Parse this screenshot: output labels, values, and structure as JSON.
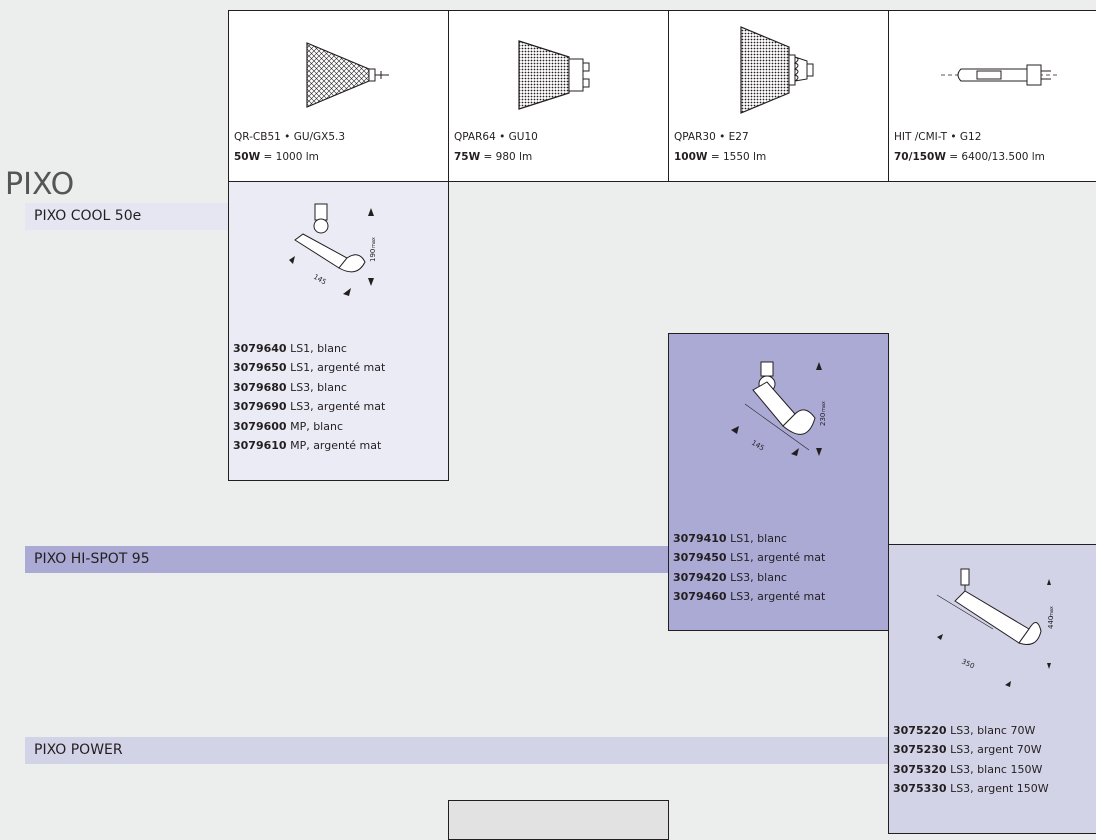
{
  "family_title": "PIXO",
  "lamps": [
    {
      "name": "QR-CB51 • GU/GX5.3",
      "power": "50W",
      "flux": " = 1000 lm",
      "icon": "mr16-reflector-lamp"
    },
    {
      "name": "QPAR64 • GU10",
      "power": "75W",
      "flux": " = 980 lm",
      "icon": "par16-gu10-lamp"
    },
    {
      "name": "QPAR30 • E27",
      "power": "100W",
      "flux": " = 1550 lm",
      "icon": "par30-e27-lamp"
    },
    {
      "name": "HIT /CMI-T • G12",
      "power": "70/150W",
      "flux": " = 6400/13.500 lm",
      "icon": "metal-halide-g12-lamp"
    }
  ],
  "products": [
    {
      "name": "PIXO COOL 50e",
      "color": "#ebebf5",
      "strip_color": "#e6e6f3",
      "dimensions": {
        "height": "190",
        "max": "max",
        "length": "145"
      },
      "codes": [
        {
          "code": "3079640",
          "desc": " LS1, blanc"
        },
        {
          "code": "3079650",
          "desc": " LS1, argenté mat"
        },
        {
          "code": "3079680",
          "desc": " LS3, blanc"
        },
        {
          "code": "3079690",
          "desc": " LS3, argenté mat"
        },
        {
          "code": "3079600",
          "desc": " MP, blanc"
        },
        {
          "code": "3079610",
          "desc": " MP, argenté mat"
        }
      ]
    },
    {
      "name": "PIXO HI-SPOT 95",
      "color": "#aaaad5",
      "strip_color": "#aaaad5",
      "dimensions": {
        "height": "230",
        "max": "max",
        "length": "145"
      },
      "codes": [
        {
          "code": "3079410",
          "desc": " LS1, blanc"
        },
        {
          "code": "3079450",
          "desc": " LS1, argenté mat"
        },
        {
          "code": "3079420",
          "desc": " LS3, blanc"
        },
        {
          "code": "3079460",
          "desc": " LS3, argenté mat"
        }
      ]
    },
    {
      "name": "PIXO POWER",
      "color": "#d3d3e8",
      "strip_color": "#d3d3e8",
      "dimensions": {
        "height": "440",
        "max": "max",
        "length": "350"
      },
      "codes": [
        {
          "code": "3075220",
          "desc": " LS3, blanc 70W"
        },
        {
          "code": "3075230",
          "desc": " LS3, argent 70W"
        },
        {
          "code": "3075320",
          "desc": " LS3, blanc 150W"
        },
        {
          "code": "3075330",
          "desc": " LS3, argent 150W"
        }
      ]
    }
  ]
}
